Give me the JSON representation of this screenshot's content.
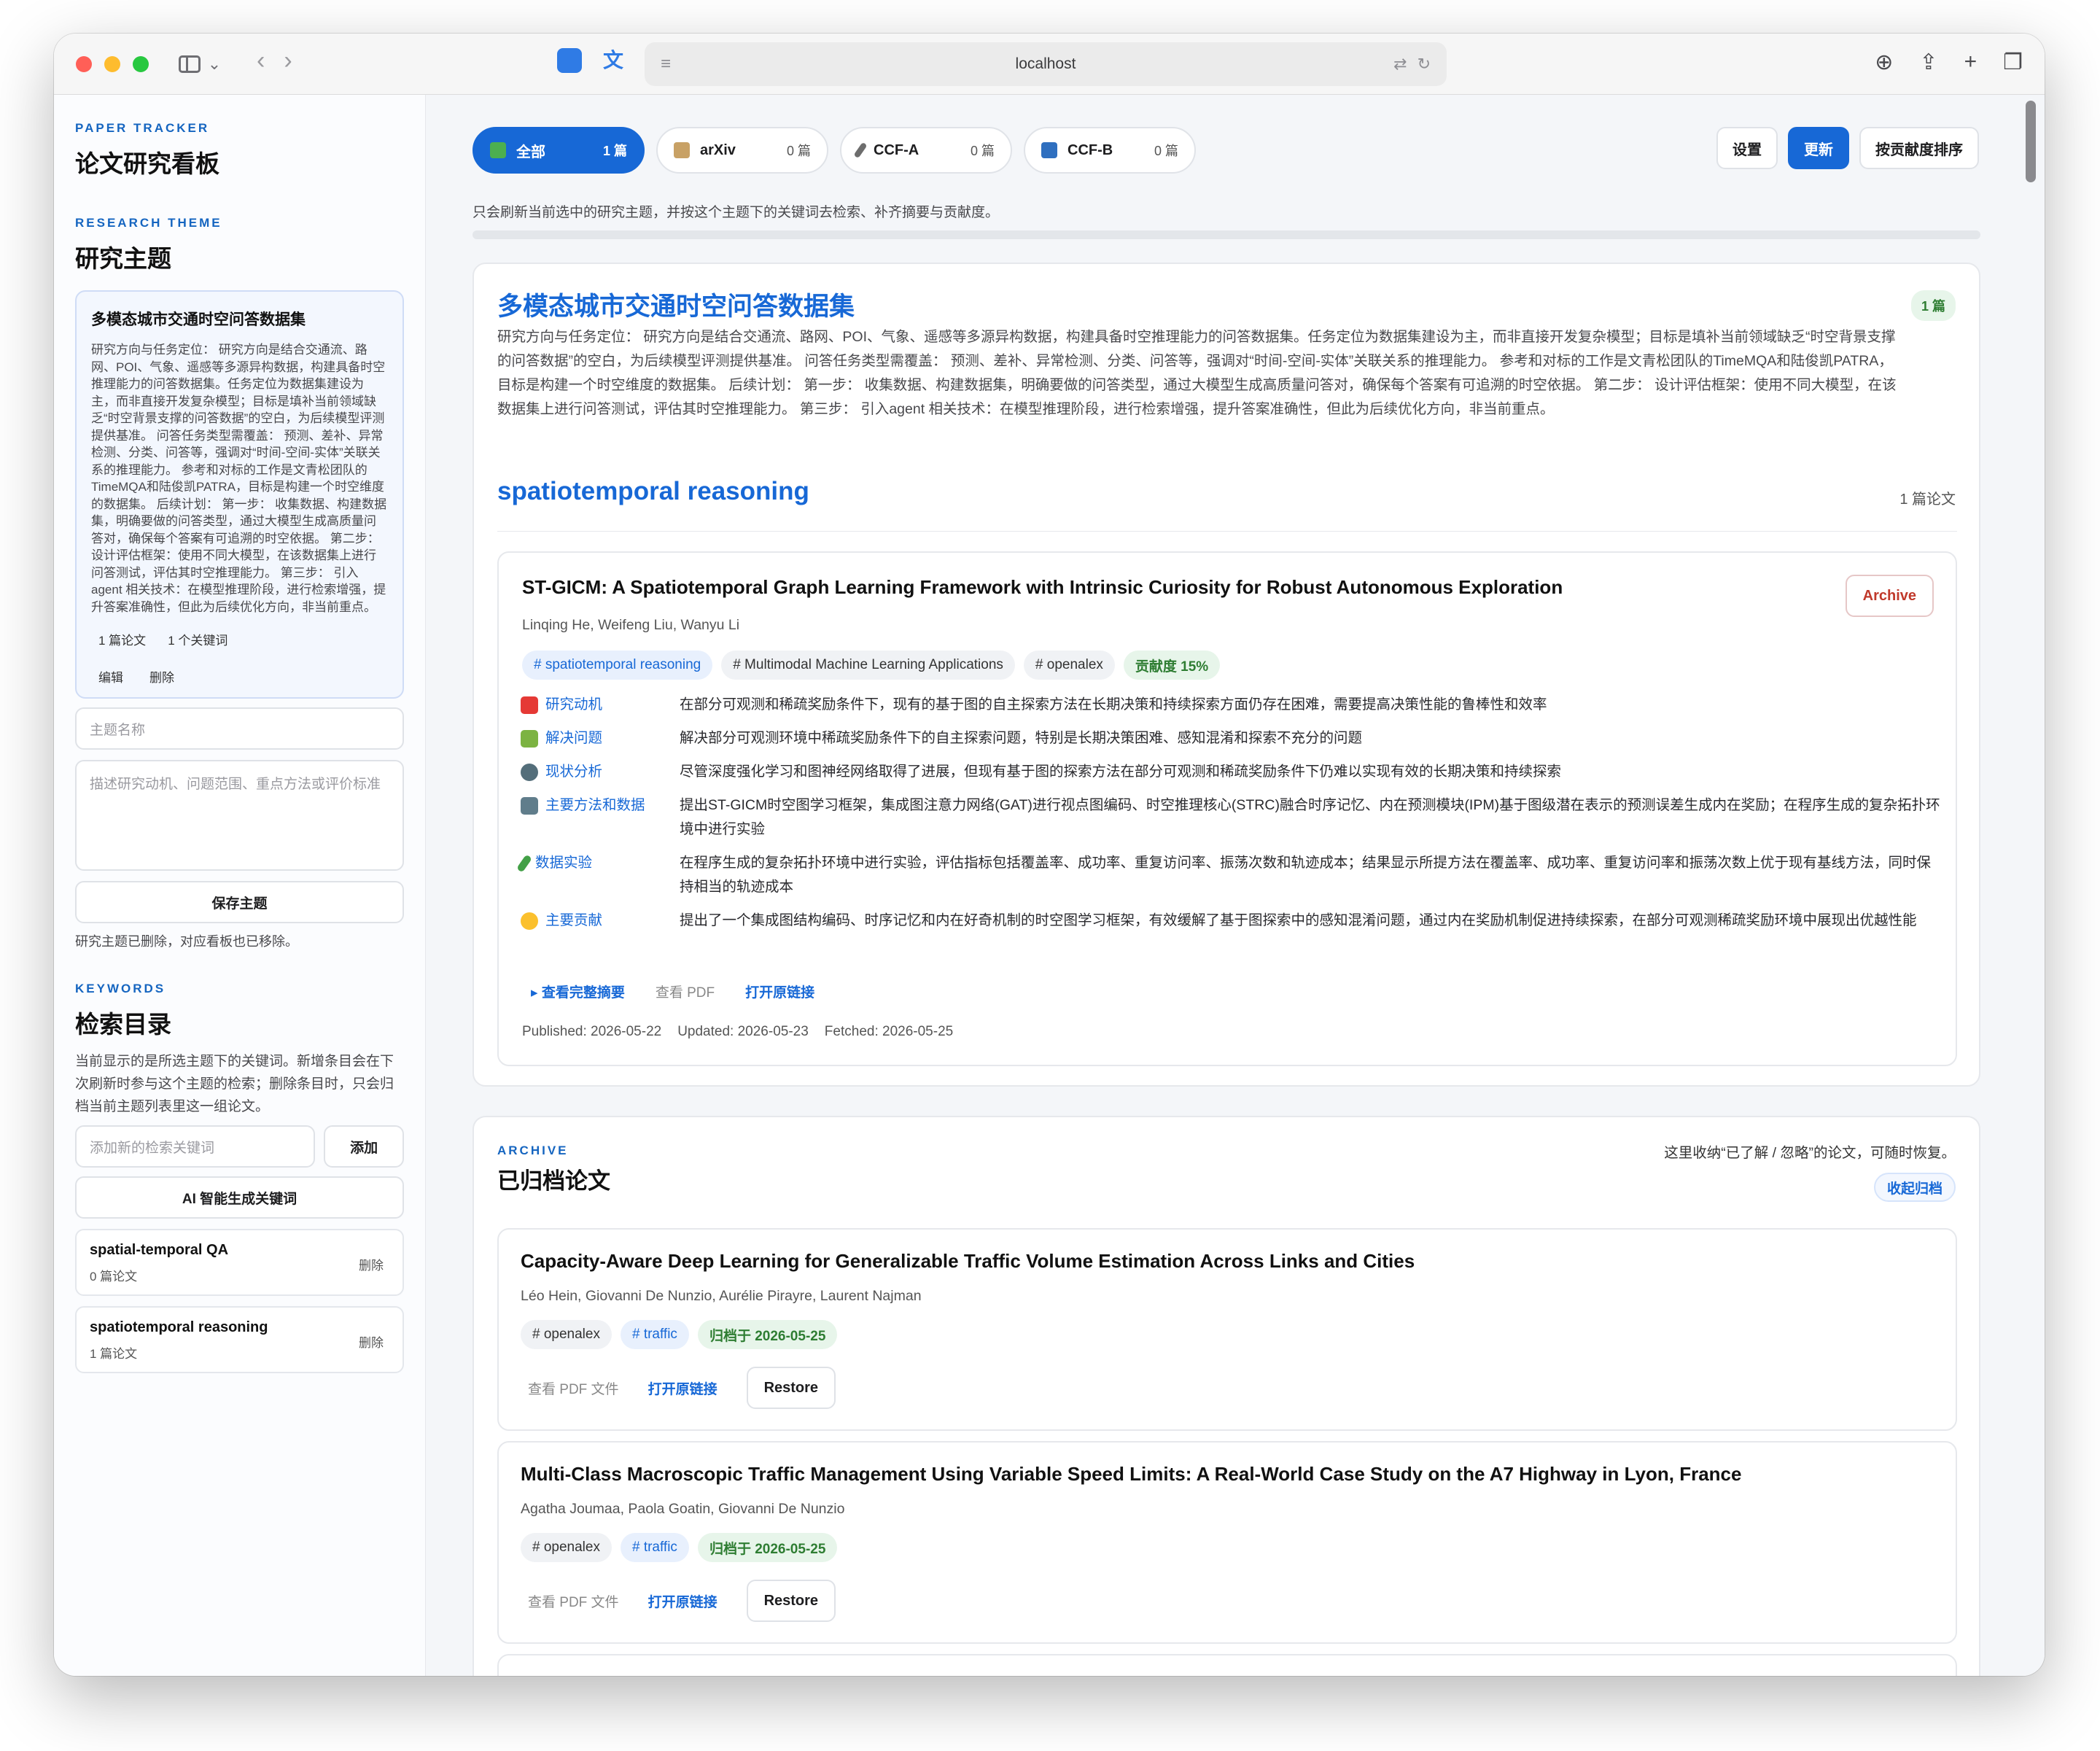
{
  "browser": {
    "address": "localhost"
  },
  "sidebar": {
    "eyebrow": "PAPER TRACKER",
    "title": "论文研究看板",
    "theme_eyebrow": "RESEARCH THEME",
    "theme_title": "研究主题",
    "theme_card": {
      "name": "多模态城市交通时空问答数据集",
      "desc": "研究方向与任务定位： 研究方向是结合交通流、路网、POI、气象、遥感等多源异构数据，构建具备时空推理能力的问答数据集。任务定位为数据集建设为主，而非直接开发复杂模型；目标是填补当前领域缺乏“时空背景支撑的问答数据”的空白，为后续模型评测提供基准。 问答任务类型需覆盖： 预测、差补、异常检测、分类、问答等，强调对“时间-空间-实体”关联关系的推理能力。 参考和对标的工作是文青松团队的TimeMQA和陆俊凯PATRA，目标是构建一个时空维度的数据集。 后续计划： 第一步： 收集数据、构建数据集，明确要做的问答类型，通过大模型生成高质量问答对，确保每个答案有可追溯的时空依据。 第二步： 设计评估框架：使用不同大模型，在该数据集上进行问答测试，评估其时空推理能力。 第三步： 引入agent 相关技术：在模型推理阶段，进行检索增强，提升答案准确性，但此为后续优化方向，非当前重点。",
      "paper_count": "1 篇论文",
      "keyword_count": "1 个关键词",
      "edit": "编辑",
      "delete": "删除"
    },
    "theme_name_placeholder": "主题名称",
    "theme_desc_placeholder": "描述研究动机、问题范围、重点方法或评价标准",
    "save_theme": "保存主题",
    "status_note": "研究主题已删除，对应看板也已移除。",
    "keywords_eyebrow": "KEYWORDS",
    "keywords_title": "检索目录",
    "keywords_note": "当前显示的是所选主题下的关键词。新增条目会在下次刷新时参与这个主题的检索；删除条目时，只会归档当前主题列表里这一组论文。",
    "keyword_placeholder": "添加新的检索关键词",
    "add": "添加",
    "ai_generate": "AI 智能生成关键词",
    "keywords": [
      {
        "name": "spatial-temporal QA",
        "count": "0 篇论文",
        "delete": "删除"
      },
      {
        "name": "spatiotemporal reasoning",
        "count": "1 篇论文",
        "delete": "删除"
      }
    ]
  },
  "filters": [
    {
      "label": "全部",
      "count": "1 篇",
      "active": true,
      "color": "#4caf50"
    },
    {
      "label": "arXiv",
      "count": "0 篇",
      "active": false,
      "color": "#c8a165"
    },
    {
      "label": "CCF-A",
      "count": "0 篇",
      "active": false,
      "color": "#6d6d6d"
    },
    {
      "label": "CCF-B",
      "count": "0 篇",
      "active": false,
      "color": "#2f6fbf"
    }
  ],
  "actions": {
    "settings": "设置",
    "refresh": "更新",
    "sort": "按贡献度排序"
  },
  "hint": "只会刷新当前选中的研究主题，并按这个主题下的关键词去检索、补齐摘要与贡献度。",
  "theme_panel": {
    "title": "多模态城市交通时空问答数据集",
    "badge": "1 篇",
    "desc": "研究方向与任务定位： 研究方向是结合交通流、路网、POI、气象、遥感等多源异构数据，构建具备时空推理能力的问答数据集。任务定位为数据集建设为主，而非直接开发复杂模型；目标是填补当前领域缺乏“时空背景支撑的问答数据”的空白，为后续模型评测提供基准。 问答任务类型需覆盖： 预测、差补、异常检测、分类、问答等，强调对“时间-空间-实体”关联关系的推理能力。 参考和对标的工作是文青松团队的TimeMQA和陆俊凯PATRA，目标是构建一个时空维度的数据集。 后续计划： 第一步： 收集数据、构建数据集，明确要做的问答类型，通过大模型生成高质量问答对，确保每个答案有可追溯的时空依据。 第二步： 设计评估框架：使用不同大模型，在该数据集上进行问答测试，评估其时空推理能力。 第三步： 引入agent 相关技术：在模型推理阶段，进行检索增强，提升答案准确性，但此为后续优化方向，非当前重点。",
    "section_title": "spatiotemporal reasoning",
    "section_count": "1 篇论文",
    "paper": {
      "title": "ST-GICM: A Spatiotemporal Graph Learning Framework with Intrinsic Curiosity for Robust Autonomous Exploration",
      "authors": "Linqing He, Weifeng Liu, Wanyu Li",
      "archive": "Archive",
      "tags": [
        "# spatiotemporal reasoning",
        "# Multimodal Machine Learning Applications",
        "# openalex"
      ],
      "contribution": "贡献度 15%",
      "fields": [
        {
          "label": "研究动机",
          "icon_color": "#e53935",
          "value": "在部分可观测和稀疏奖励条件下，现有的基于图的自主探索方法在长期决策和持续探索方面仍存在困难，需要提高决策性能的鲁棒性和效率"
        },
        {
          "label": "解决问题",
          "icon_color": "#7cb342",
          "value": "解决部分可观测环境中稀疏奖励条件下的自主探索问题，特别是长期决策困难、感知混淆和探索不充分的问题"
        },
        {
          "label": "现状分析",
          "icon_color": "#546e7a",
          "value": "尽管深度强化学习和图神经网络取得了进展，但现有基于图的探索方法在部分可观测和稀疏奖励条件下仍难以实现有效的长期决策和持续探索"
        },
        {
          "label": "主要方法和数据",
          "icon_color": "#607d8b",
          "value": "提出ST-GICM时空图学习框架，集成图注意力网络(GAT)进行视点图编码、时空推理核心(STRC)融合时序记忆、内在预测模块(IPM)基于图级潜在表示的预测误差生成内在奖励；在程序生成的复杂拓扑环境中进行实验"
        },
        {
          "label": "数据实验",
          "icon_color": "#43a047",
          "value": "在程序生成的复杂拓扑环境中进行实验，评估指标包括覆盖率、成功率、重复访问率、振荡次数和轨迹成本；结果显示所提方法在覆盖率、成功率、重复访问率和振荡次数上优于现有基线方法，同时保持相当的轨迹成本"
        },
        {
          "label": "主要贡献",
          "icon_color": "#fbc02d",
          "value": "提出了一个集成图结构编码、时序记忆和内在好奇机制的时空图学习框架，有效缓解了基于图探索中的感知混淆问题，通过内在奖励机制促进持续探索，在部分可观测稀疏奖励环境中展现出优越性能"
        }
      ],
      "links": {
        "abstract": "▸ 查看完整摘要",
        "pdf": "查看 PDF",
        "origin": "打开原链接"
      },
      "published": "Published: 2026-05-22",
      "updated": "Updated: 2026-05-23",
      "fetched": "Fetched: 2026-05-25"
    }
  },
  "archive": {
    "eyebrow": "ARCHIVE",
    "title": "已归档论文",
    "note": "这里收纳“已了解 / 忽略”的论文，可随时恢复。",
    "collapse": "收起归档",
    "papers": [
      {
        "title": "Capacity-Aware Deep Learning for Generalizable Traffic Volume Estimation Across Links and Cities",
        "authors": "Léo Hein, Giovanni De Nunzio, Aurélie Pirayre, Laurent Najman",
        "tags": [
          "# openalex",
          "# traffic"
        ],
        "archived": "归档于 2026-05-25",
        "pdf": "查看 PDF 文件",
        "origin": "打开原链接",
        "restore": "Restore"
      },
      {
        "title": "Multi-Class Macroscopic Traffic Management Using Variable Speed Limits: A Real-World Case Study on the A7 Highway in Lyon, France",
        "authors": "Agatha Joumaa, Paola Goatin, Giovanni De Nunzio",
        "tags": [
          "# openalex",
          "# traffic"
        ],
        "archived": "归档于 2026-05-25",
        "pdf": "查看 PDF 文件",
        "origin": "打开原链接",
        "restore": "Restore"
      }
    ]
  }
}
